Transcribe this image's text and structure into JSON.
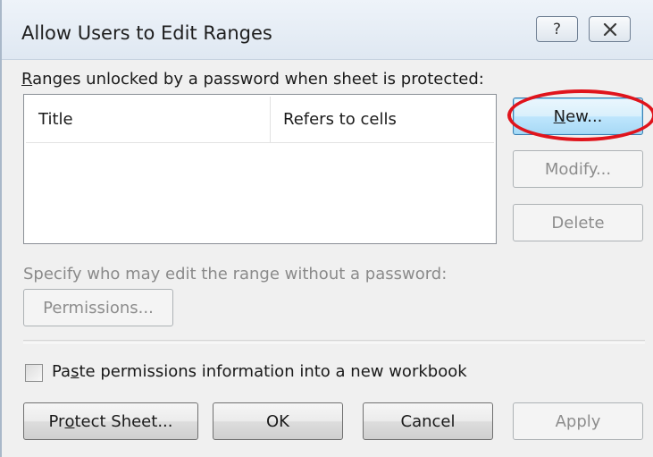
{
  "dialog": {
    "title": "Allow Users to Edit Ranges",
    "help_glyph": "?",
    "ranges_label_first": "R",
    "ranges_label_rest": "anges unlocked by a password when sheet is protected:",
    "columns": [
      "Title",
      "Refers to cells"
    ],
    "rows": [],
    "specify_label": "Specify who may edit the range without a password:",
    "paste_label_pre": "Pa",
    "paste_label_mnemonic": "s",
    "paste_label_post": "te permissions information into a new workbook",
    "paste_checked": false
  },
  "buttons": {
    "new_mnemonic": "N",
    "new_rest": "ew...",
    "modify": "Modify...",
    "delete": "Delete",
    "permissions": "Permissions...",
    "protect_pre": "Pr",
    "protect_mnemonic": "o",
    "protect_post": "tect Sheet...",
    "ok": "OK",
    "cancel": "Cancel",
    "apply": "Apply"
  },
  "annotation": {
    "highlight_color": "#e0141c",
    "highlight_target": "new-button"
  },
  "icons": {
    "help": "question-mark-icon",
    "close": "close-icon"
  }
}
